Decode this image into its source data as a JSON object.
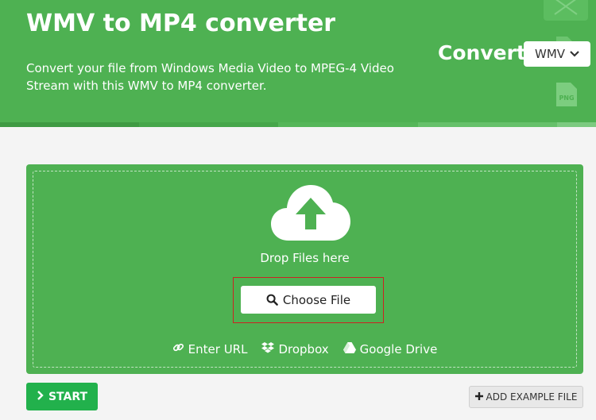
{
  "header": {
    "title": "WMV to MP4 converter",
    "description": "Convert your file from Windows Media Video to MPEG-4 Video Stream with this WMV to MP4 converter.",
    "convert_label": "Convert",
    "format_value": "WMV",
    "deco_png_label": "PNG"
  },
  "upload": {
    "drop_text": "Drop Files here",
    "choose_file_label": "Choose File",
    "links": {
      "url": "Enter URL",
      "dropbox": "Dropbox",
      "gdrive": "Google Drive"
    }
  },
  "actions": {
    "start_label": "START",
    "example_label": "ADD EXAMPLE FILE"
  },
  "colors": {
    "brand_green": "#4eb152",
    "start_green": "#22b14c",
    "highlight_red": "#cc2222"
  },
  "icons": {
    "upload": "cloud-upload-icon",
    "search": "search-icon",
    "link": "link-icon",
    "dropbox": "dropbox-icon",
    "gdrive": "google-drive-icon",
    "start": "chevron-right-icon",
    "add": "plus-icon",
    "dropdown": "chevron-down-icon"
  }
}
